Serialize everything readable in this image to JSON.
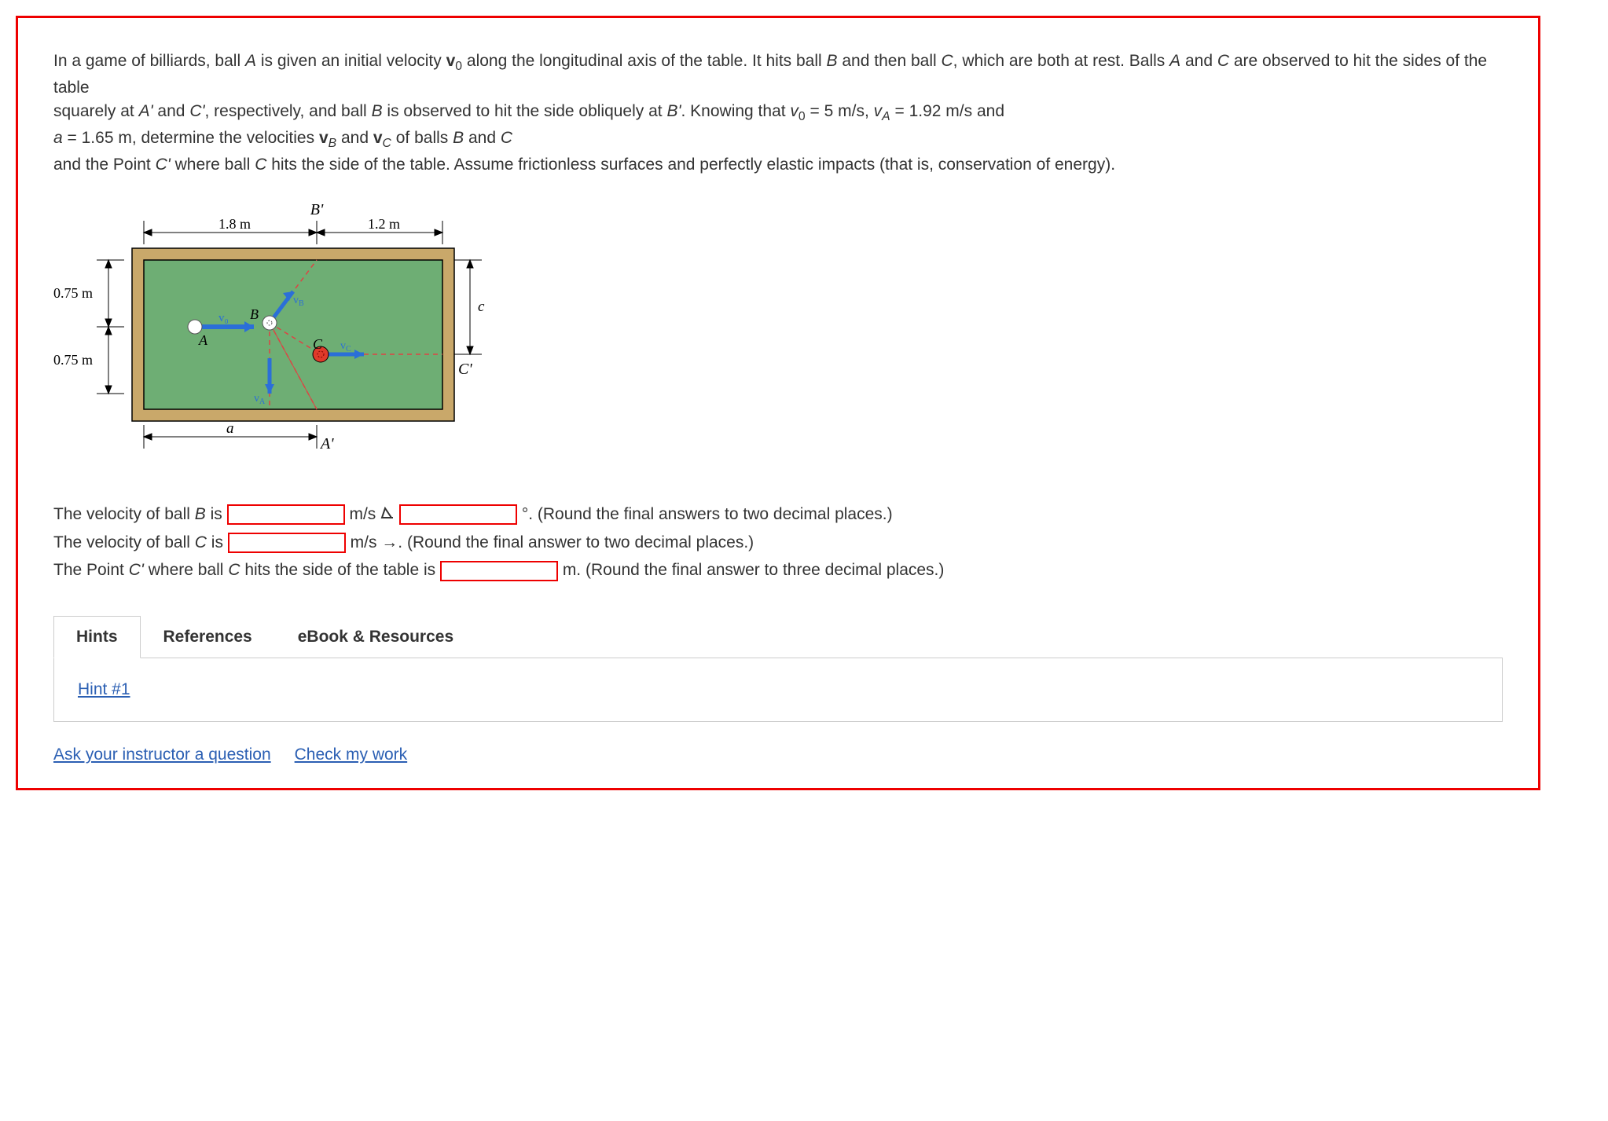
{
  "problem": {
    "p1a": "In a game of billiards, ball ",
    "ballA": "A",
    "p1b": " is given an initial velocity ",
    "v0": "v",
    "v0sub": "0",
    "p1c": " along the longitudinal axis of the table. It hits ball ",
    "ballB": "B",
    "p1d": " and then ball ",
    "ballC": "C",
    "p1e": ", which are both at rest. Balls ",
    "p1f": " and ",
    "p1g": " are observed to hit the sides of the table",
    "p2a": "squarely at ",
    "Aprime": "A'",
    "p2b": " and ",
    "Cprime": "C'",
    "p2c": ", respectively, and ball ",
    "p2d": " is observed to hit the side obliquely at ",
    "Bprime": "B'",
    "p2e": ". Knowing that ",
    "v0val": " = 5 m/s, ",
    "vA": "v",
    "vAsub": "A",
    "vAval": " = 1.92 m/s  and",
    "p3a": "a",
    "p3b": " = 1.65 m, determine the velocities ",
    "vB": "v",
    "vBsub": "B",
    "p3c": " and ",
    "vC": "v",
    "vCsub": "C",
    "p3d": " of balls ",
    "p3e": " and ",
    "p4a": "and the Point ",
    "p4b": " where ball ",
    "p4c": " hits the side of the table. Assume frictionless surfaces and perfectly elastic impacts (that is, conservation of energy)."
  },
  "figure": {
    "dim_1_8": "1.8 m",
    "dim_1_2": "1.2 m",
    "dim_075a": "0.75 m",
    "dim_075b": "0.75 m",
    "dim_a": "a",
    "dim_c": "c",
    "label_A": "A",
    "label_B": "B",
    "label_C": "C",
    "label_Ap": "A'",
    "label_Bp": "B'",
    "label_Cp": "C'",
    "label_v0": "v₀",
    "label_vA": "v_A",
    "label_vB": "v_B",
    "label_vC": "v_C"
  },
  "answers": {
    "line1a": "The velocity of ball ",
    "line1b": " is ",
    "line1c": " m/s ",
    "line1d": "°. (Round the final answers to two decimal places.)",
    "line2a": "The velocity of ball ",
    "line2b": " is ",
    "line2c": " m/s →. (Round the final answer to two decimal places.)",
    "line3a": "The Point ",
    "line3b": " where ball ",
    "line3c": " hits the side of the table is ",
    "line3d": " m. (Round the final answer to three decimal places.)"
  },
  "tabs": {
    "hints": "Hints",
    "references": "References",
    "ebook": "eBook & Resources",
    "hint1": "Hint #1"
  },
  "links": {
    "ask": "Ask your instructor a question",
    "check": "Check my work"
  }
}
